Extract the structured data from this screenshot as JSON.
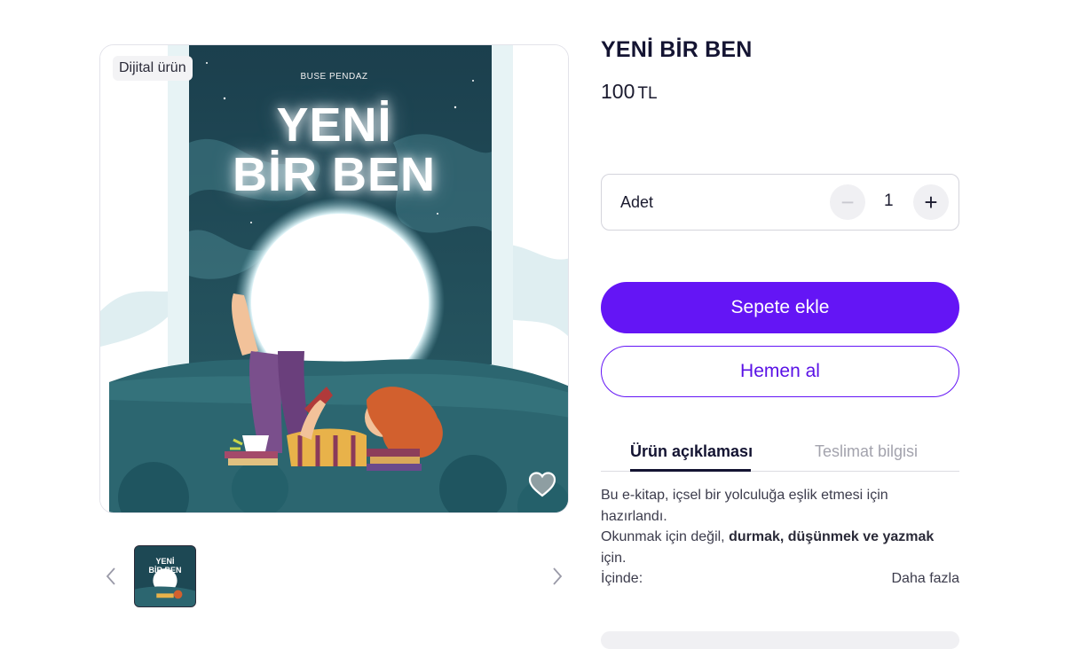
{
  "gallery": {
    "badge": "Dijital ürün",
    "cover_author": "BUSE PENDAZ",
    "cover_title_line1": "YENİ",
    "cover_title_line2": "BİR BEN",
    "favorite_icon": "heart-icon",
    "prev_icon": "chevron-left-icon",
    "next_icon": "chevron-right-icon"
  },
  "thumbnail": {
    "title_line1": "YENİ",
    "title_line2": "BİR BEN"
  },
  "product": {
    "title": "YENİ BİR BEN",
    "price_value": "100",
    "price_currency": "TL"
  },
  "quantity": {
    "label": "Adet",
    "value": "1",
    "minus": "−",
    "plus": "+"
  },
  "actions": {
    "add_to_cart": "Sepete ekle",
    "buy_now": "Hemen al"
  },
  "tabs": {
    "description": "Ürün açıklaması",
    "delivery": "Teslimat bilgisi"
  },
  "description": {
    "line1": "Bu e-kitap, içsel bir yolculuğa eşlik etmesi için",
    "line2": "hazırlandı.",
    "line3_start": "Okunmak için değil, ",
    "line3_bold": "durmak, düşünmek ve yazmak",
    "line4": "için.",
    "line5": "İçinde:",
    "more": "Daha fazla"
  },
  "colors": {
    "primary": "#6415f5",
    "cover_background": "#1d4854",
    "text_dark": "#141432"
  }
}
